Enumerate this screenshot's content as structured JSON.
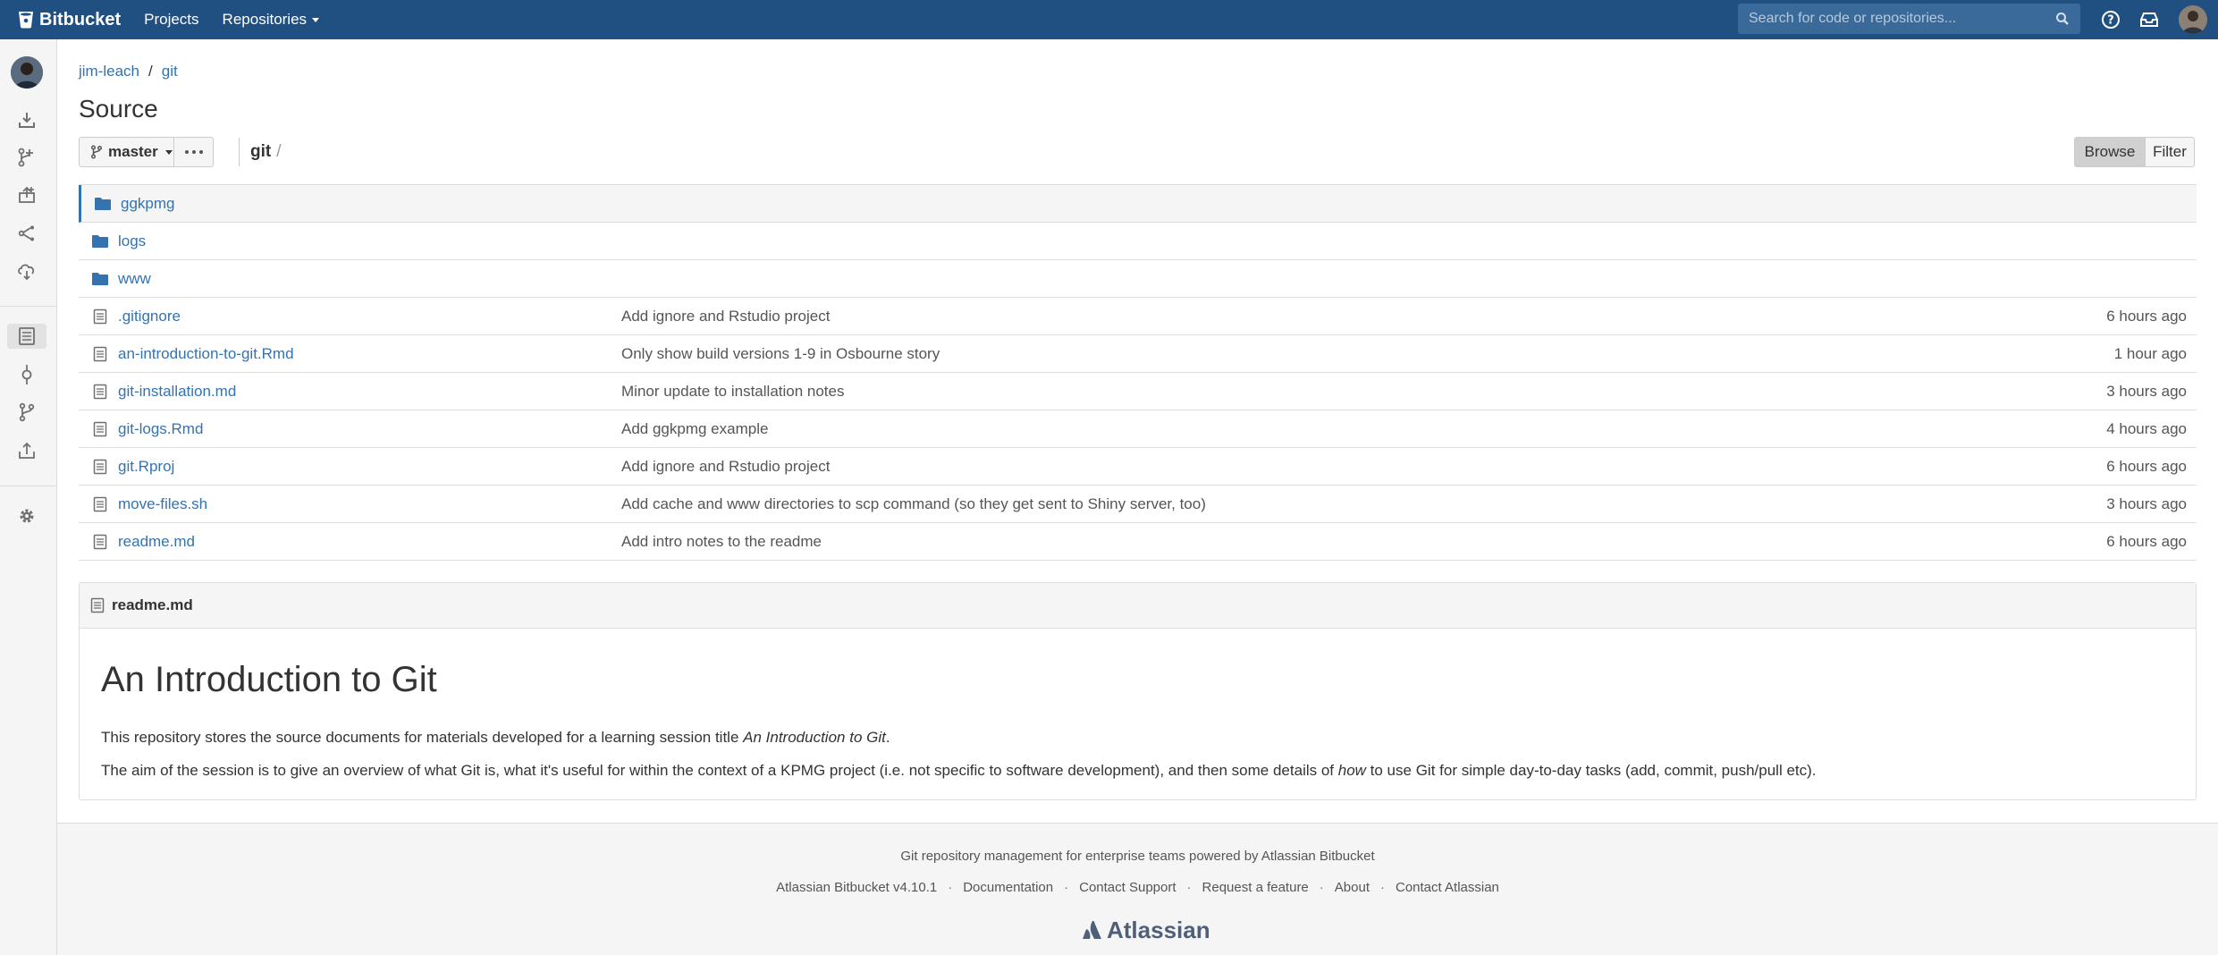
{
  "topbar": {
    "brand": "Bitbucket",
    "nav": [
      {
        "label": "Projects"
      },
      {
        "label": "Repositories"
      }
    ],
    "search_placeholder": "Search for code or repositories..."
  },
  "breadcrumb": {
    "project": "jim-leach",
    "separator": "/",
    "repo": "git"
  },
  "page_title": "Source",
  "toolbar": {
    "branch": "master",
    "path_root": "git",
    "path_slash": "/",
    "browse_label": "Browse",
    "filter_label": "Filter"
  },
  "files": [
    {
      "type": "folder",
      "name": "ggkpmg",
      "message": "",
      "time": ""
    },
    {
      "type": "folder",
      "name": "logs",
      "message": "",
      "time": ""
    },
    {
      "type": "folder",
      "name": "www",
      "message": "",
      "time": ""
    },
    {
      "type": "file",
      "name": ".gitignore",
      "message": "Add ignore and Rstudio project",
      "time": "6 hours ago"
    },
    {
      "type": "file",
      "name": "an-introduction-to-git.Rmd",
      "message": "Only show build versions 1-9 in Osbourne story",
      "time": "1 hour ago"
    },
    {
      "type": "file",
      "name": "git-installation.md",
      "message": "Minor update to installation notes",
      "time": "3 hours ago"
    },
    {
      "type": "file",
      "name": "git-logs.Rmd",
      "message": "Add ggkpmg example",
      "time": "4 hours ago"
    },
    {
      "type": "file",
      "name": "git.Rproj",
      "message": "Add ignore and Rstudio project",
      "time": "6 hours ago"
    },
    {
      "type": "file",
      "name": "move-files.sh",
      "message": "Add cache and www directories to scp command (so they get sent to Shiny server, too)",
      "time": "3 hours ago"
    },
    {
      "type": "file",
      "name": "readme.md",
      "message": "Add intro notes to the readme",
      "time": "6 hours ago"
    }
  ],
  "readme": {
    "filename": "readme.md",
    "heading": "An Introduction to Git",
    "p1_before": "This repository stores the source documents for materials developed for a learning session title ",
    "p1_em": "An Introduction to Git",
    "p1_after": ".",
    "p2_before": "The aim of the session is to give an overview of what Git is, what it's useful for within the context of a KPMG project (i.e. not specific to software development), and then some details of ",
    "p2_em": "how",
    "p2_after": " to use Git for simple day-to-day tasks (add, commit, push/pull etc)."
  },
  "footer": {
    "tagline": "Git repository management for enterprise teams powered by Atlassian Bitbucket",
    "links": [
      "Atlassian Bitbucket v4.10.1",
      "Documentation",
      "Contact Support",
      "Request a feature",
      "About",
      "Contact Atlassian"
    ],
    "separator": "·",
    "brand": "Atlassian"
  },
  "colors": {
    "header_bg": "#205081",
    "link": "#3572b0",
    "folder": "#3572b0"
  },
  "icons": {
    "topbar": [
      "bitbucket-logo-icon",
      "search-icon",
      "help-icon",
      "inbox-icon",
      "user-avatar"
    ],
    "sidebar": [
      "clone-icon",
      "create-pull-request-icon",
      "upload-icon",
      "fork-icon",
      "sync-icon",
      "source-icon",
      "commits-icon",
      "branches-icon",
      "pull-requests-icon",
      "settings-icon"
    ]
  }
}
